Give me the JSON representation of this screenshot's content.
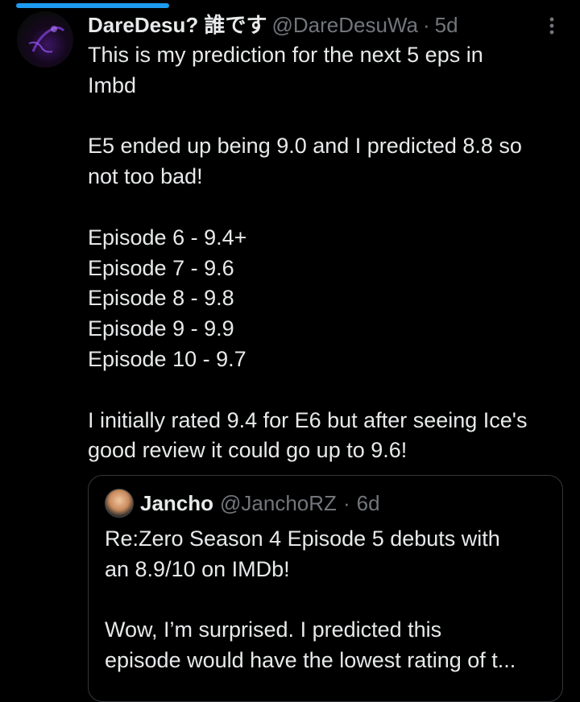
{
  "tweet": {
    "name": "DareDesu? 誰です",
    "handle": "@DareDesuWa",
    "separator": "·",
    "time": "5d",
    "paragraphs": [
      [
        "This is my prediction for the next 5 eps in",
        "Imbd"
      ],
      [
        "E5 ended up being 9.0 and I predicted 8.8 so",
        "not too bad!"
      ],
      [
        "Episode 6 - 9.4+",
        "Episode 7 - 9.6",
        "Episode 8 - 9.8",
        "Episode 9 - 9.9",
        "Episode 10 - 9.7"
      ],
      [
        "I initially rated 9.4 for E6 but after seeing Ice's",
        "good review it could go up to 9.6!"
      ]
    ]
  },
  "quote": {
    "name": "Jancho",
    "handle": "@JanchoRZ",
    "separator": "·",
    "time": "6d",
    "paragraphs": [
      [
        "Re:Zero Season 4 Episode 5 debuts with",
        "an 8.9/10 on IMDb!"
      ],
      [
        "Wow, I’m surprised. I predicted this",
        "episode would have the lowest rating of t..."
      ]
    ]
  },
  "icons": {
    "more": "more-vertical-icon",
    "avatar": "user-avatar",
    "quote_avatar": "quoted-user-avatar"
  },
  "colors": {
    "background": "#000000",
    "text": "#e7e9ea",
    "muted": "#71767b",
    "accent": "#1d9bf0",
    "border": "#333639"
  }
}
